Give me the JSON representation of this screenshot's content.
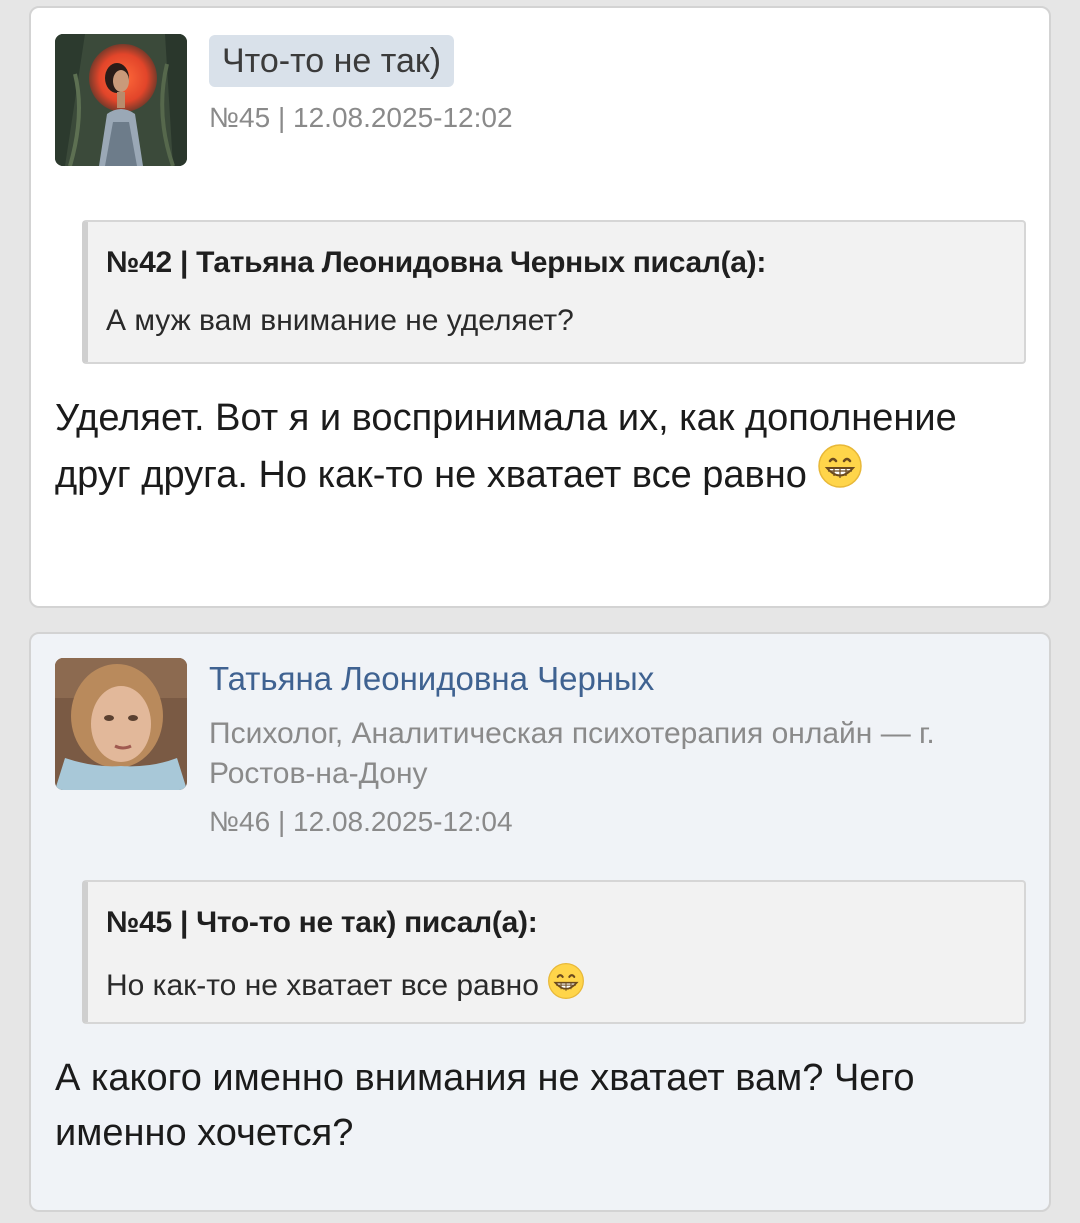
{
  "post1": {
    "username": "Что-то не так)",
    "meta": "№45 | 12.08.2025-12:02",
    "quote": {
      "header": "№42 | Татьяна Леонидовна Черных писал(а):",
      "text": "А муж вам внимание не уделяет?"
    },
    "body": "Уделяет. Вот я и воспринимала их, как дополнение друг друга. Но как-то не хватает все равно",
    "body_emoji": "grinning-face-icon"
  },
  "post2": {
    "author_name": "Татьяна Леонидовна Черных",
    "author_role": "Психолог, Аналитическая психотерапия онлайн — г. Ростов-на-Дону",
    "meta": "№46 | 12.08.2025-12:04",
    "quote": {
      "header": "№45 | Что-то не так) писал(а):",
      "text": "Но как-то не хватает все равно",
      "emoji": "grinning-face-icon"
    },
    "body": "А какого именно внимания не хватает вам? Чего именно хочется?"
  },
  "colors": {
    "page_bg": "#e6e6e6",
    "card1_bg": "#ffffff",
    "card2_bg": "#f0f3f7",
    "author_link": "#3f6291",
    "username_chip": "#d9e1ea",
    "quote_bg": "#f2f2f2"
  }
}
